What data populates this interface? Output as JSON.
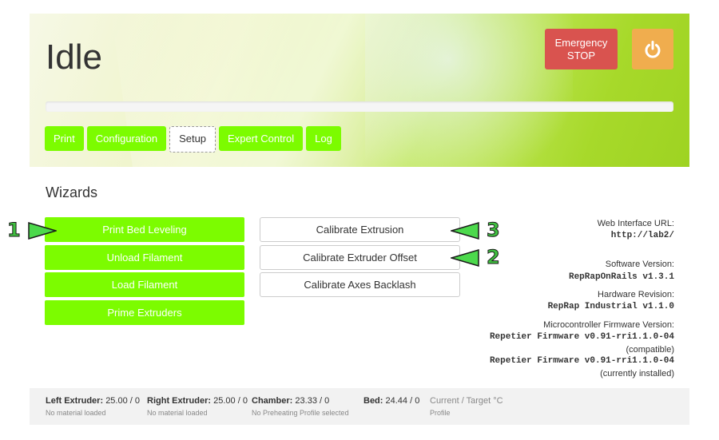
{
  "header": {
    "status": "Idle",
    "emergency_stop_label": "Emergency STOP",
    "progress_percent": 0,
    "tabs": [
      {
        "label": "Print",
        "active": false
      },
      {
        "label": "Configuration",
        "active": false
      },
      {
        "label": "Setup",
        "active": true
      },
      {
        "label": "Expert Control",
        "active": false
      },
      {
        "label": "Log",
        "active": false
      }
    ]
  },
  "wizards": {
    "title": "Wizards",
    "left_buttons": [
      "Print Bed Leveling",
      "Unload Filament",
      "Load Filament",
      "Prime Extruders"
    ],
    "center_buttons": [
      "Calibrate Extrusion",
      "Calibrate Extruder Offset",
      "Calibrate Axes Backlash"
    ]
  },
  "info": {
    "web_url_label": "Web Interface URL:",
    "web_url": "http://lab2/",
    "software_label": "Software Version:",
    "software": "RepRapOnRails v1.3.1",
    "hardware_label": "Hardware Revision:",
    "hardware": "RepRap Industrial v1.1.0",
    "firmware_label": "Microcontroller Firmware Version:",
    "firmware_compatible": "Repetier Firmware v0.91-rri1.1.0-04",
    "compatible_note": "(compatible)",
    "firmware_installed": "Repetier Firmware v0.91-rri1.1.0-04",
    "installed_note": "(currently installed)"
  },
  "footer": {
    "left_extruder_label": "Left Extruder:",
    "left_extruder_value": "25.00 / 0",
    "left_extruder_sub": "No material loaded",
    "right_extruder_label": "Right Extruder:",
    "right_extruder_value": "25.00 / 0",
    "right_extruder_sub": "No material loaded",
    "chamber_label": "Chamber:",
    "chamber_value": "23.33 / 0",
    "chamber_sub": "No Preheating Profile selected",
    "bed_label": "Bed:",
    "bed_value": "24.44 / 0",
    "units_label": "Current / Target °C",
    "units_sub": "Profile"
  },
  "annotations": [
    "1",
    "2",
    "3"
  ],
  "colors": {
    "accent_green": "#7cfc00",
    "estop_red": "#d9534f",
    "power_orange": "#f0ad4e",
    "arrow_green": "#4cd94c"
  },
  "icons": {
    "power": "power-icon",
    "arrow": "arrow-icon"
  }
}
